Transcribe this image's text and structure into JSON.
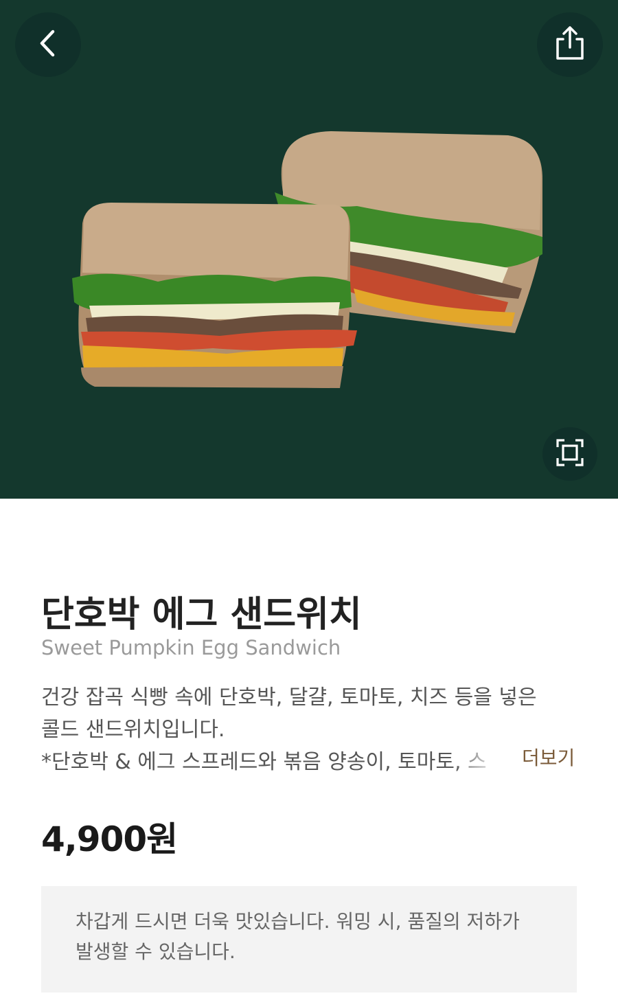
{
  "header": {
    "back_icon": "chevron-left-icon",
    "share_icon": "share-icon",
    "zoom_icon": "fullscreen-icon",
    "hero_background": "#14382d"
  },
  "product": {
    "name_ko": "단호박 에그 샌드위치",
    "name_en": "Sweet Pumpkin Egg Sandwich",
    "description_lines": [
      "건강 잡곡 식빵 속에 단호박, 달걀, 토마토, 치즈 등을 넣은",
      "콜드 샌드위치입니다.",
      "*단호박 & 에그 스프레드와 볶음 양송이, 토마토, 스"
    ],
    "more_label": "더보기",
    "price": "4,900원",
    "notice": "차갑게 드시면 더욱 맛있습니다. 워밍 시, 품질의 저하가 발생할 수 있습니다."
  },
  "colors": {
    "accent_more": "#7a5a38",
    "notice_bg": "#f3f3f3"
  }
}
